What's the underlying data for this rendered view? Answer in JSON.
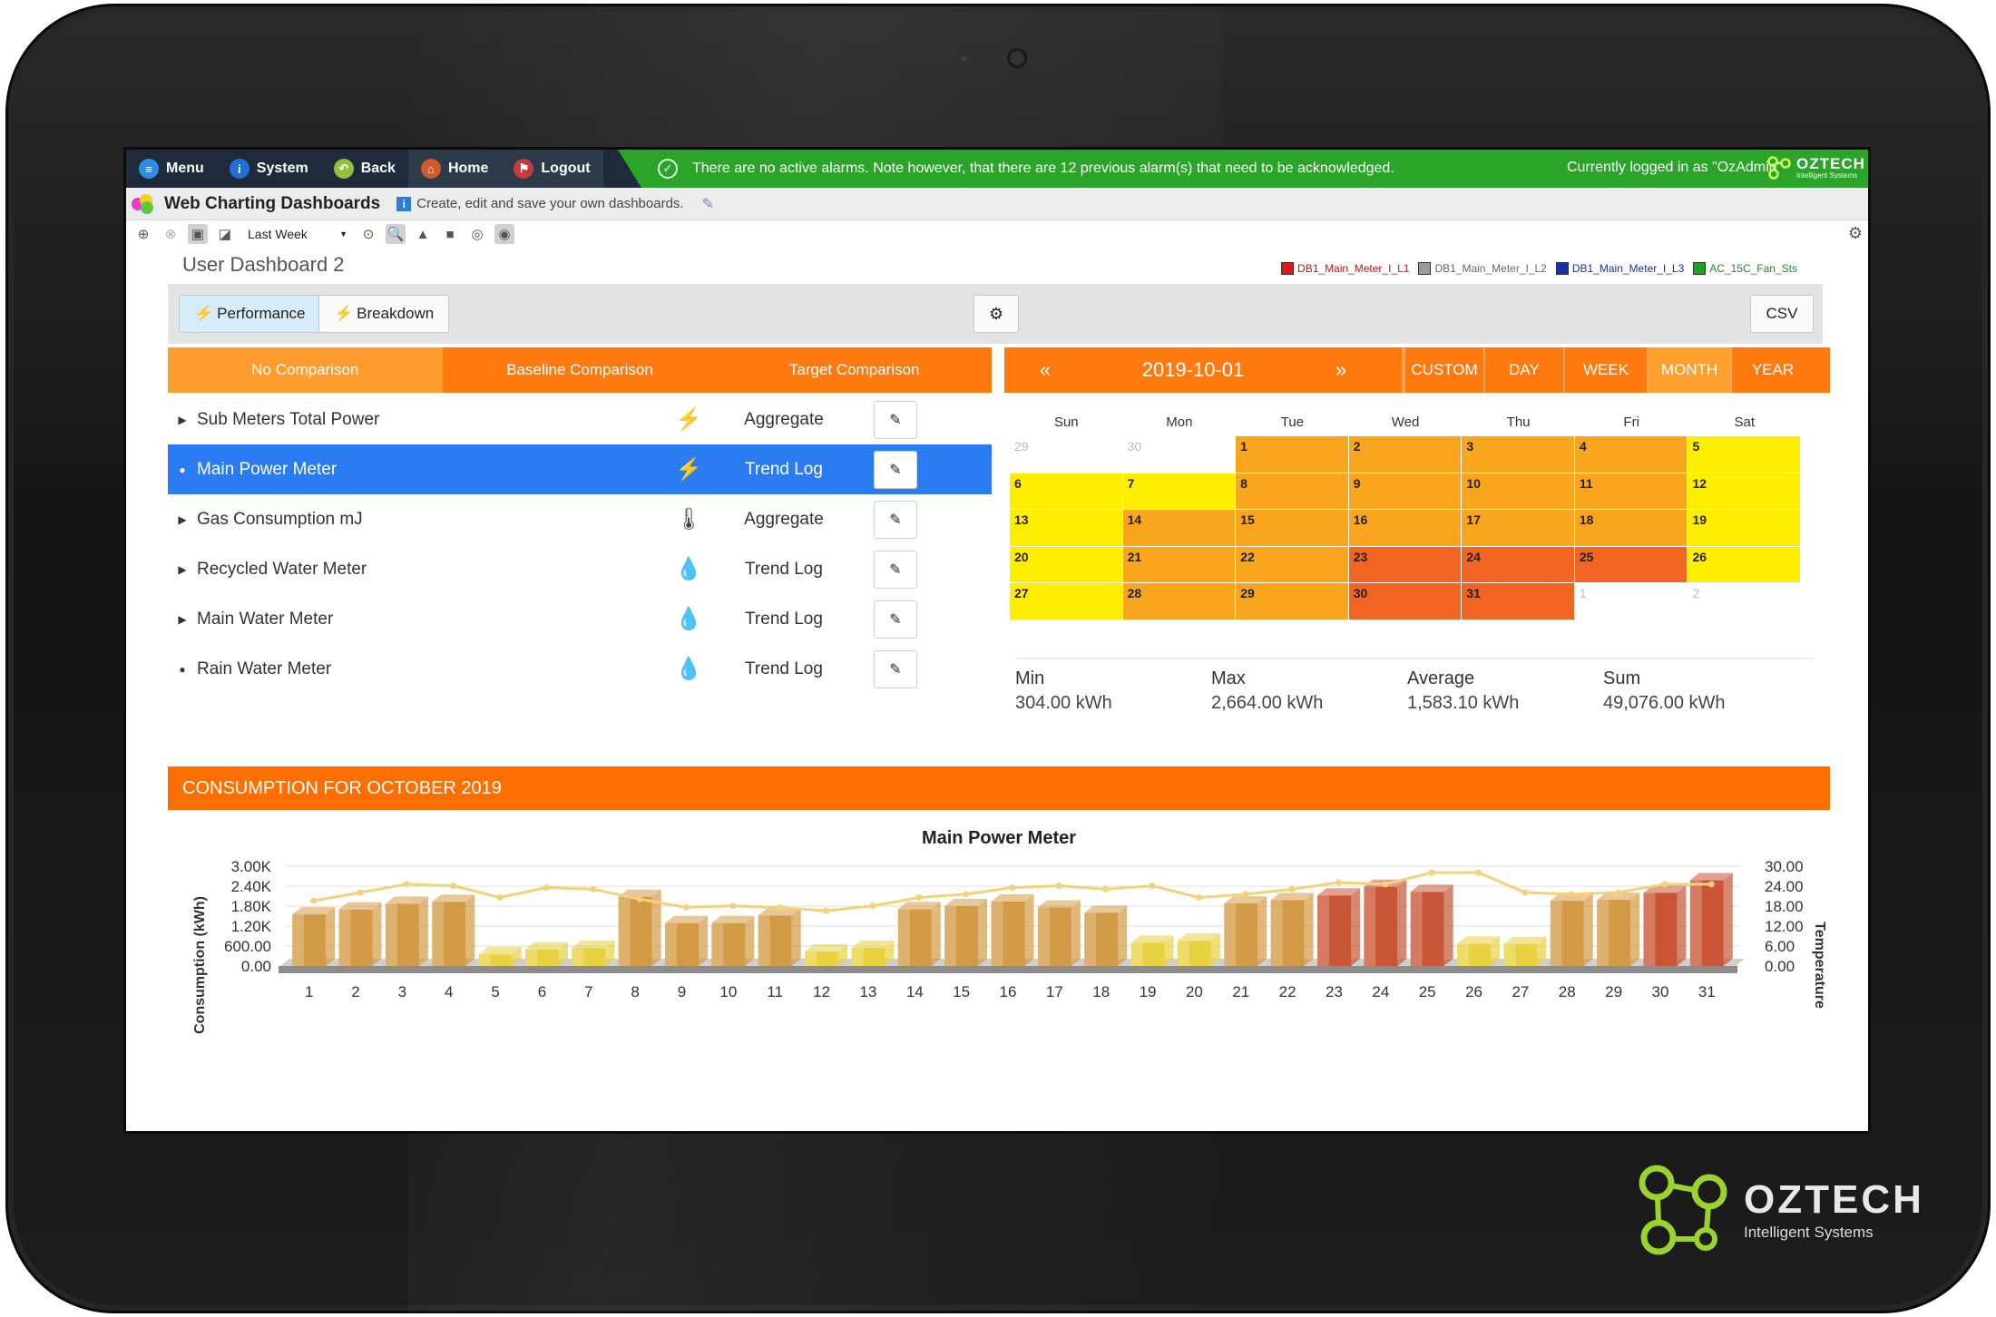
{
  "topbar": {
    "nav": [
      {
        "label": "Menu",
        "icon": "menu-icon",
        "color": "#2e8ee5"
      },
      {
        "label": "System",
        "icon": "info-icon",
        "color": "#1e70d8"
      },
      {
        "label": "Back",
        "icon": "back-icon",
        "color": "#8fc13a"
      },
      {
        "label": "Home",
        "icon": "home-icon",
        "color": "#d05a2a"
      },
      {
        "label": "Logout",
        "icon": "logout-icon",
        "color": "#c83a3a"
      }
    ],
    "alarm_text": "There are no active alarms. Note however, that there are 12 previous alarm(s) that need to be acknowledged.",
    "login_text": "Currently logged in as \"OzAdmin\"",
    "brand_name": "OZTECH",
    "brand_tag": "Intelligent Systems"
  },
  "titlerow": {
    "title": "Web Charting Dashboards",
    "subtitle": "Create, edit and save your own dashboards."
  },
  "toolbar": {
    "range_select": "Last Week"
  },
  "dashboard": {
    "title": "User Dashboard 2",
    "legend": [
      {
        "label": "DB1_Main_Meter_I_L1",
        "color": "#d81b1b",
        "text_color": "#c21616"
      },
      {
        "label": "DB1_Main_Meter_I_L2",
        "color": "#9a9a9a",
        "text_color": "#666666"
      },
      {
        "label": "DB1_Main_Meter_I_L3",
        "color": "#1b2fa6",
        "text_color": "#1b2fa6"
      },
      {
        "label": "AC_15C_Fan_Sts",
        "color": "#20a020",
        "text_color": "#1c8c1c"
      }
    ],
    "performance_label": "Performance",
    "breakdown_label": "Breakdown",
    "csv_label": "CSV"
  },
  "comparison_tabs": [
    "No Comparison",
    "Baseline Comparison",
    "Target Comparison"
  ],
  "meters": [
    {
      "name": "Sub Meters Total Power",
      "type": "Aggregate",
      "icon": "lightning-icon",
      "glyph": "⚡",
      "caret": "▶",
      "selected": false
    },
    {
      "name": "Main Power Meter",
      "type": "Trend Log",
      "icon": "lightning-icon",
      "glyph": "⚡",
      "caret": "●",
      "selected": true
    },
    {
      "name": "Gas Consumption mJ",
      "type": "Aggregate",
      "icon": "thermometer-icon",
      "glyph": "🌡",
      "caret": "▶",
      "selected": false
    },
    {
      "name": "Recycled Water Meter",
      "type": "Trend Log",
      "icon": "water-drop-icon",
      "glyph": "💧",
      "caret": "▶",
      "selected": false
    },
    {
      "name": "Main Water Meter",
      "type": "Trend Log",
      "icon": "water-drop-icon",
      "glyph": "💧",
      "caret": "▶",
      "selected": false
    },
    {
      "name": "Rain Water Meter",
      "type": "Trend Log",
      "icon": "water-drop-icon",
      "glyph": "💧",
      "caret": "●",
      "selected": false
    }
  ],
  "calendar": {
    "prev": "«",
    "next": "»",
    "date": "2019-10-01",
    "segments": [
      "CUSTOM",
      "DAY",
      "WEEK",
      "MONTH",
      "YEAR"
    ],
    "active_segment": "MONTH",
    "weekdays": [
      "Sun",
      "Mon",
      "Tue",
      "Wed",
      "Thu",
      "Fri",
      "Sat"
    ],
    "colors": {
      "low": "#ffee00",
      "mid": "#f9a51e",
      "high": "#f26422",
      "out": "#ffffff"
    },
    "weeks": [
      [
        {
          "d": "29",
          "l": "out"
        },
        {
          "d": "30",
          "l": "out"
        },
        {
          "d": "1",
          "l": "mid"
        },
        {
          "d": "2",
          "l": "mid"
        },
        {
          "d": "3",
          "l": "mid"
        },
        {
          "d": "4",
          "l": "mid"
        },
        {
          "d": "5",
          "l": "low"
        }
      ],
      [
        {
          "d": "6",
          "l": "low"
        },
        {
          "d": "7",
          "l": "low"
        },
        {
          "d": "8",
          "l": "mid"
        },
        {
          "d": "9",
          "l": "mid"
        },
        {
          "d": "10",
          "l": "mid"
        },
        {
          "d": "11",
          "l": "mid"
        },
        {
          "d": "12",
          "l": "low"
        }
      ],
      [
        {
          "d": "13",
          "l": "low"
        },
        {
          "d": "14",
          "l": "mid"
        },
        {
          "d": "15",
          "l": "mid"
        },
        {
          "d": "16",
          "l": "mid"
        },
        {
          "d": "17",
          "l": "mid"
        },
        {
          "d": "18",
          "l": "mid"
        },
        {
          "d": "19",
          "l": "low"
        }
      ],
      [
        {
          "d": "20",
          "l": "low"
        },
        {
          "d": "21",
          "l": "mid"
        },
        {
          "d": "22",
          "l": "mid"
        },
        {
          "d": "23",
          "l": "high"
        },
        {
          "d": "24",
          "l": "high"
        },
        {
          "d": "25",
          "l": "high"
        },
        {
          "d": "26",
          "l": "low"
        }
      ],
      [
        {
          "d": "27",
          "l": "low"
        },
        {
          "d": "28",
          "l": "mid"
        },
        {
          "d": "29",
          "l": "mid"
        },
        {
          "d": "30",
          "l": "high"
        },
        {
          "d": "31",
          "l": "high"
        },
        {
          "d": "1",
          "l": "out"
        },
        {
          "d": "2",
          "l": "out"
        }
      ]
    ]
  },
  "stats": [
    {
      "label": "Min",
      "value": "304.00 kWh"
    },
    {
      "label": "Max",
      "value": "2,664.00 kWh"
    },
    {
      "label": "Average",
      "value": "1,583.10 kWh"
    },
    {
      "label": "Sum",
      "value": "49,076.00 kWh"
    }
  ],
  "consumption_title": "CONSUMPTION FOR OCTOBER 2019",
  "chart_data": {
    "type": "bar",
    "title": "Main Power Meter",
    "ylabel": "Consumption (kWh)",
    "y2label": "Temperature",
    "ylim": [
      0,
      3000
    ],
    "y2lim": [
      0,
      30
    ],
    "yticks": [
      "0.00",
      "600.00",
      "1.20K",
      "1.80K",
      "2.40K",
      "3.00K"
    ],
    "y2ticks": [
      "0.00",
      "6.00",
      "12.00",
      "18.00",
      "24.00",
      "30.00"
    ],
    "categories": [
      "1",
      "2",
      "3",
      "4",
      "5",
      "6",
      "7",
      "8",
      "9",
      "10",
      "11",
      "12",
      "13",
      "14",
      "15",
      "16",
      "17",
      "18",
      "19",
      "20",
      "21",
      "22",
      "23",
      "24",
      "25",
      "26",
      "27",
      "28",
      "29",
      "30",
      "31"
    ],
    "series": [
      {
        "values": [
          1550,
          1700,
          1870,
          1930,
          350,
          500,
          550,
          2080,
          1290,
          1290,
          1520,
          440,
          550,
          1710,
          1800,
          1940,
          1760,
          1600,
          700,
          760,
          1880,
          1980,
          2120,
          2380,
          2230,
          670,
          660,
          1960,
          1990,
          2200,
          2580
        ],
        "colors": [
          "mid",
          "mid",
          "mid",
          "mid",
          "low",
          "low",
          "low",
          "mid",
          "mid",
          "mid",
          "mid",
          "low",
          "low",
          "mid",
          "mid",
          "mid",
          "mid",
          "mid",
          "low",
          "low",
          "mid",
          "mid",
          "high",
          "high",
          "high",
          "low",
          "low",
          "mid",
          "mid",
          "high",
          "high"
        ]
      },
      {
        "values": [
          18.5,
          21.0,
          23.5,
          23.0,
          19.5,
          22.5,
          22.0,
          19.0,
          16.5,
          17.0,
          16.5,
          15.5,
          17.0,
          19.5,
          20.5,
          22.5,
          23.0,
          22.0,
          23.0,
          19.5,
          20.5,
          22.0,
          24.0,
          23.5,
          27.0,
          27.0,
          21.0,
          20.5,
          21.0,
          23.5,
          23.5
        ]
      }
    ],
    "palette": {
      "low": "#e8d240",
      "mid": "#d39a45",
      "high": "#c85535",
      "line": "#f3d27a"
    }
  }
}
